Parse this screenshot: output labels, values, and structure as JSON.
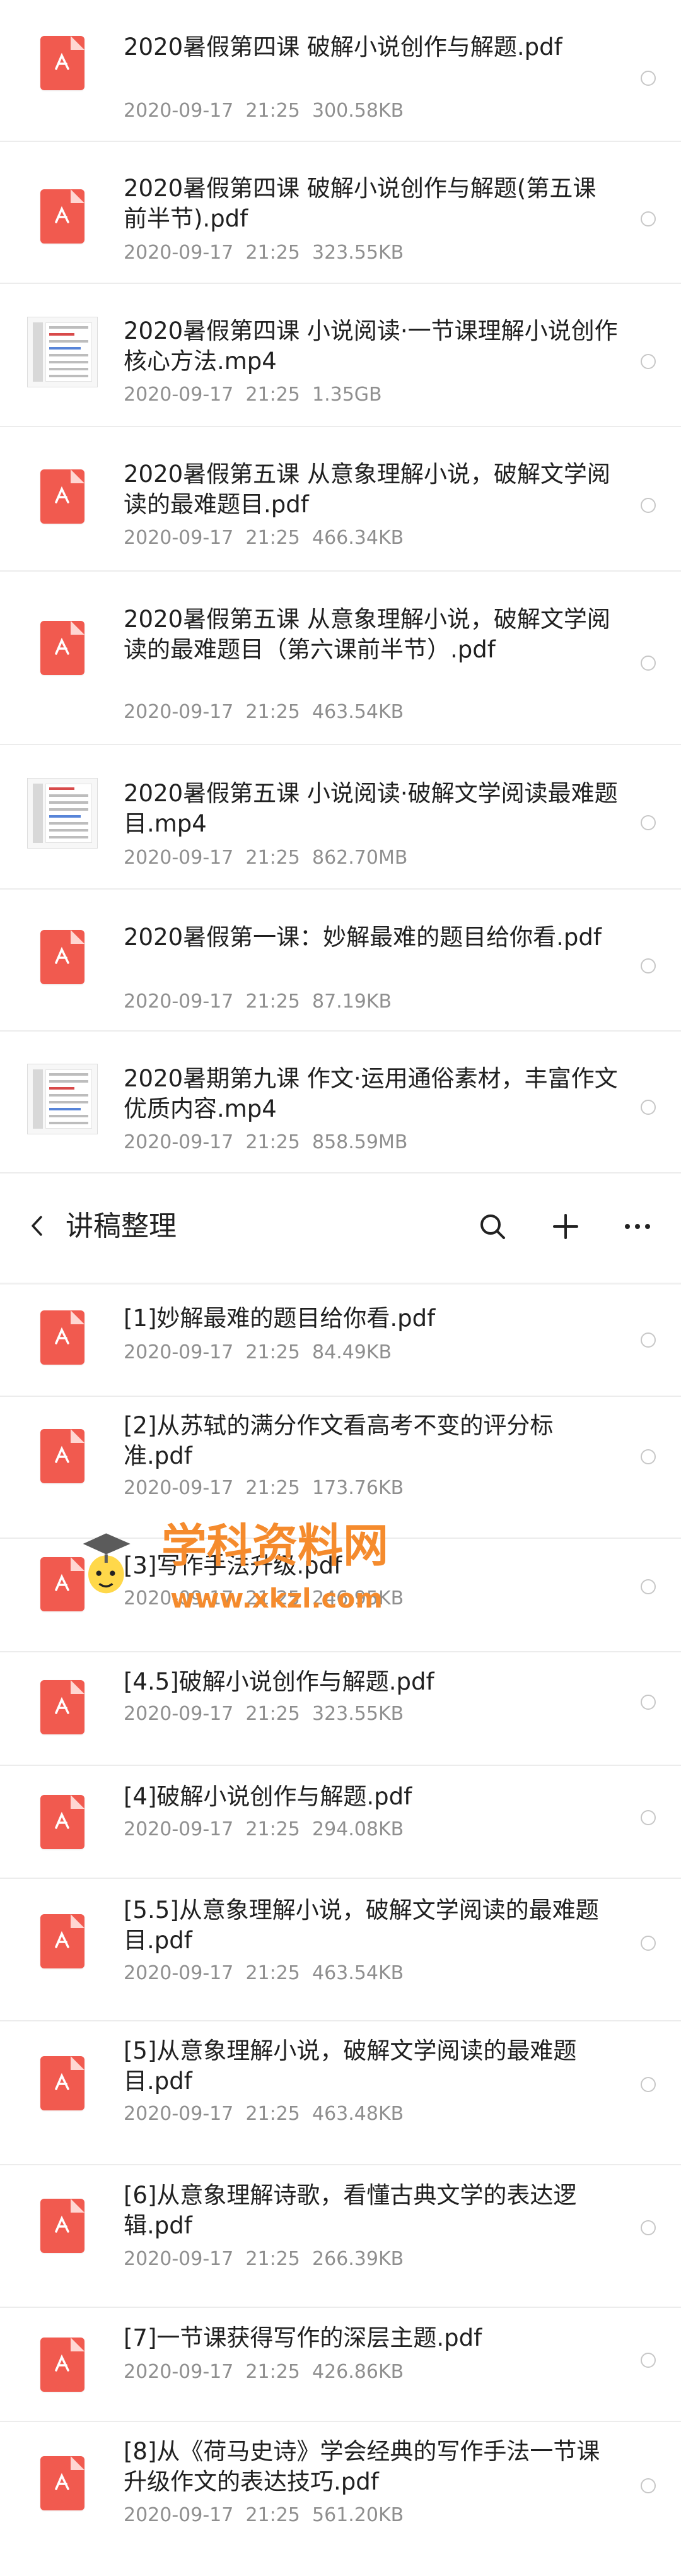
{
  "files_top": [
    {
      "name": "2020暑假第四课  破解小说创作与解题.pdf",
      "date": "2020-09-17",
      "time": "21:25",
      "size": "300.58KB",
      "type": "pdf"
    },
    {
      "name": "2020暑假第四课 破解小说创作与解题(第五课前半节).pdf",
      "date": "2020-09-17",
      "time": "21:25",
      "size": "323.55KB",
      "type": "pdf"
    },
    {
      "name": "2020暑假第四课 小说阅读·一节课理解小说创作核心方法.mp4",
      "date": "2020-09-17",
      "time": "21:25",
      "size": "1.35GB",
      "type": "video"
    },
    {
      "name": "2020暑假第五课  从意象理解小说，破解文学阅读的最难题目.pdf",
      "date": "2020-09-17",
      "time": "21:25",
      "size": "466.34KB",
      "type": "pdf"
    },
    {
      "name": "2020暑假第五课 从意象理解小说，破解文学阅读的最难题目（第六课前半节）.pdf",
      "date": "2020-09-17",
      "time": "21:25",
      "size": "463.54KB",
      "type": "pdf"
    },
    {
      "name": "2020暑假第五课 小说阅读·破解文学阅读最难题目.mp4",
      "date": "2020-09-17",
      "time": "21:25",
      "size": "862.70MB",
      "type": "video"
    },
    {
      "name": "2020暑假第一课：妙解最难的题目给你看.pdf",
      "date": "2020-09-17",
      "time": "21:25",
      "size": "87.19KB",
      "type": "pdf"
    },
    {
      "name": "2020暑期第九课 作文·运用通俗素材，丰富作文优质内容.mp4",
      "date": "2020-09-17",
      "time": "21:25",
      "size": "858.59MB",
      "type": "video"
    }
  ],
  "header": {
    "title": "讲稿整理"
  },
  "files_bottom": [
    {
      "name": "[1]妙解最难的题目给你看.pdf",
      "date": "2020-09-17",
      "time": "21:25",
      "size": "84.49KB",
      "type": "pdf"
    },
    {
      "name": "[2]从苏轼的满分作文看高考不变的评分标准.pdf",
      "date": "2020-09-17",
      "time": "21:25",
      "size": "173.76KB",
      "type": "pdf"
    },
    {
      "name": "[3]写作手法升级.pdf",
      "date": "2020-09-17",
      "time": "21:25",
      "size": "246.95KB",
      "type": "pdf"
    },
    {
      "name": "[4.5]破解小说创作与解题.pdf",
      "date": "2020-09-17",
      "time": "21:25",
      "size": "323.55KB",
      "type": "pdf"
    },
    {
      "name": "[4]破解小说创作与解题.pdf",
      "date": "2020-09-17",
      "time": "21:25",
      "size": "294.08KB",
      "type": "pdf"
    },
    {
      "name": "[5.5]从意象理解小说，破解文学阅读的最难题目.pdf",
      "date": "2020-09-17",
      "time": "21:25",
      "size": "463.54KB",
      "type": "pdf"
    },
    {
      "name": "[5]从意象理解小说，破解文学阅读的最难题目.pdf",
      "date": "2020-09-17",
      "time": "21:25",
      "size": "463.48KB",
      "type": "pdf"
    },
    {
      "name": "[6]从意象理解诗歌，看懂古典文学的表达逻辑.pdf",
      "date": "2020-09-17",
      "time": "21:25",
      "size": "266.39KB",
      "type": "pdf"
    },
    {
      "name": "[7]一节课获得写作的深层主题.pdf",
      "date": "2020-09-17",
      "time": "21:25",
      "size": "426.86KB",
      "type": "pdf"
    },
    {
      "name": "[8]从《荷马史诗》学会经典的写作手法一节课升级作文的表达技巧.pdf",
      "date": "2020-09-17",
      "time": "21:25",
      "size": "561.20KB",
      "type": "pdf"
    }
  ],
  "watermark": {
    "text": "学科资料网",
    "url": "www.xkzl.com"
  }
}
